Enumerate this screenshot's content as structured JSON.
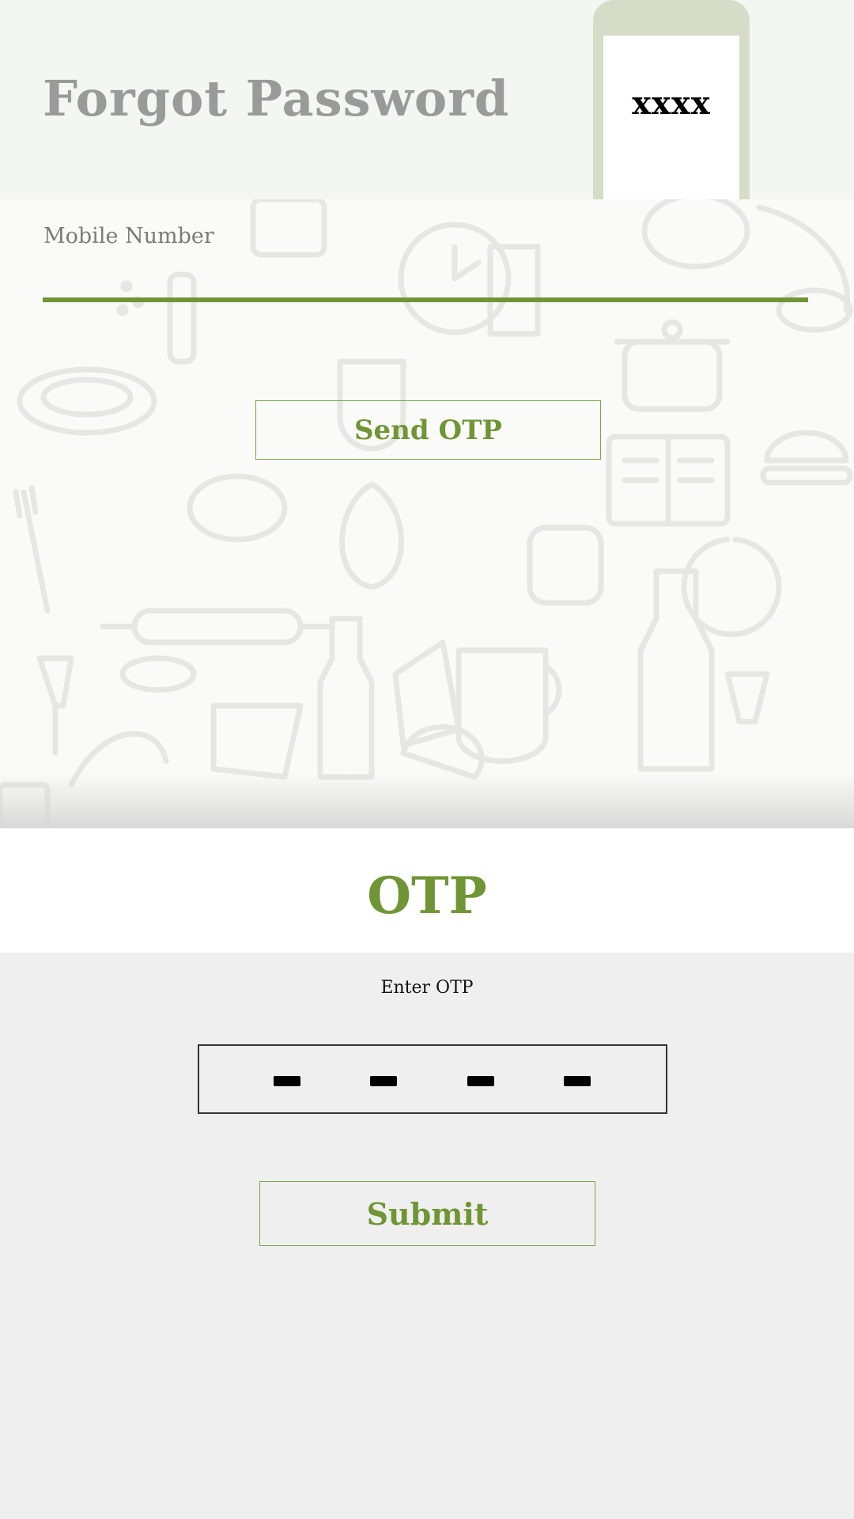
{
  "header": {
    "title": "Forgot Password",
    "phone_code": "xxxx"
  },
  "form": {
    "mobile_label": "Mobile Number",
    "mobile_value": "",
    "send_label": "Send OTP"
  },
  "otp": {
    "title": "OTP",
    "prompt": "Enter OTP",
    "digits": [
      "",
      "",
      "",
      ""
    ],
    "submit_label": "Submit"
  },
  "colors": {
    "accent": "#6f9534",
    "header_bg": "#f4f7f1",
    "phone_frame": "#d5ddc9",
    "body_bg": "#efefef",
    "title_gray": "#9a9a9a"
  },
  "icons": [
    "phone-illustration",
    "food-doodle-pattern"
  ]
}
